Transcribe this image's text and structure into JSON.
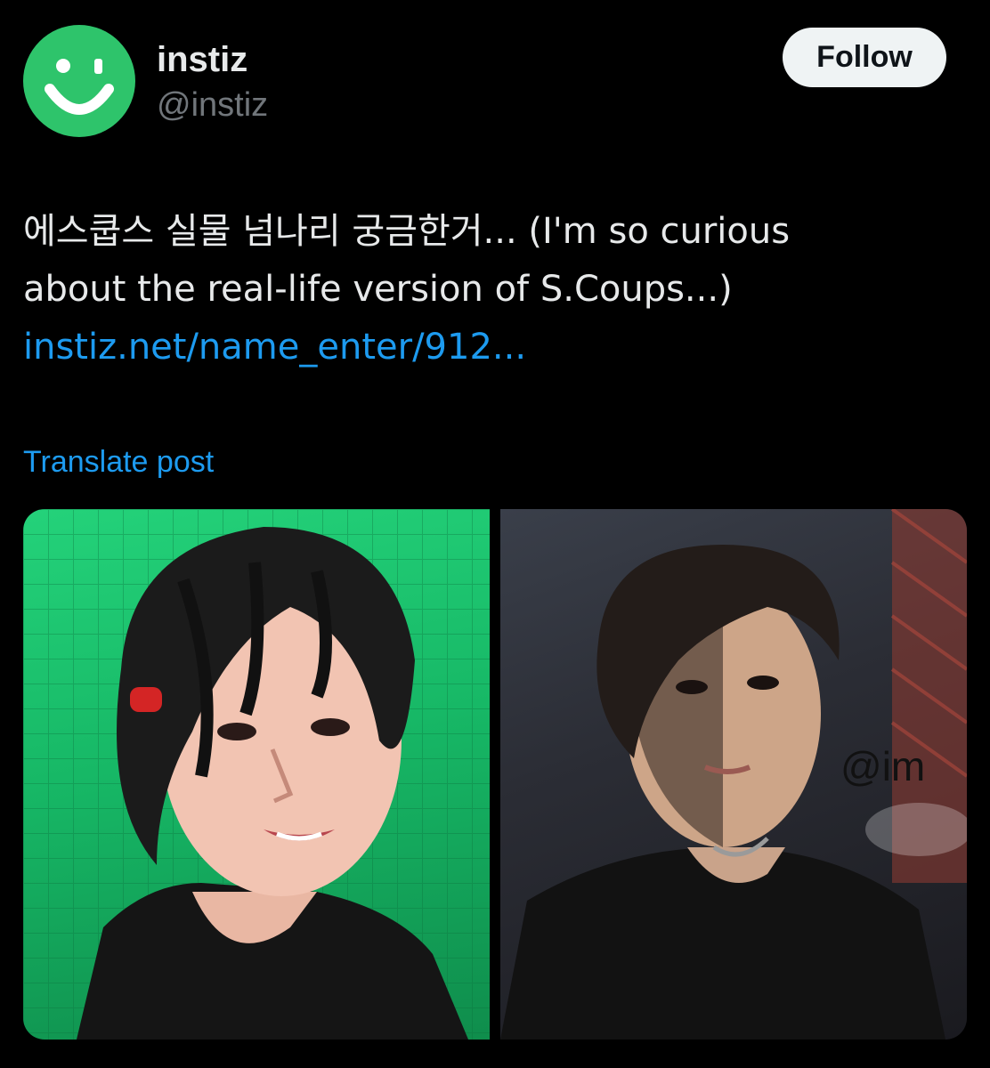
{
  "author": {
    "display_name": "instiz",
    "handle": "@instiz",
    "avatar_color": "#2ec46b",
    "avatar_icon": "smiley-logo-icon"
  },
  "actions": {
    "follow_label": "Follow"
  },
  "post": {
    "text_line_1": "에스쿱스 실물 넘나리 궁금한거... (I'm so curious",
    "text_line_2": "about the real-life version of S.Coups...)",
    "link": "instiz.net/name_enter/912...",
    "translate_label": "Translate post"
  },
  "media": {
    "images": [
      {
        "name": "photo-left",
        "watermark": ""
      },
      {
        "name": "photo-right",
        "watermark": "@im"
      }
    ]
  },
  "colors": {
    "background": "#000000",
    "text": "#e7e9ea",
    "secondary_text": "#71767b",
    "link": "#1d9bf0",
    "follow_button_bg": "#eff3f4"
  }
}
